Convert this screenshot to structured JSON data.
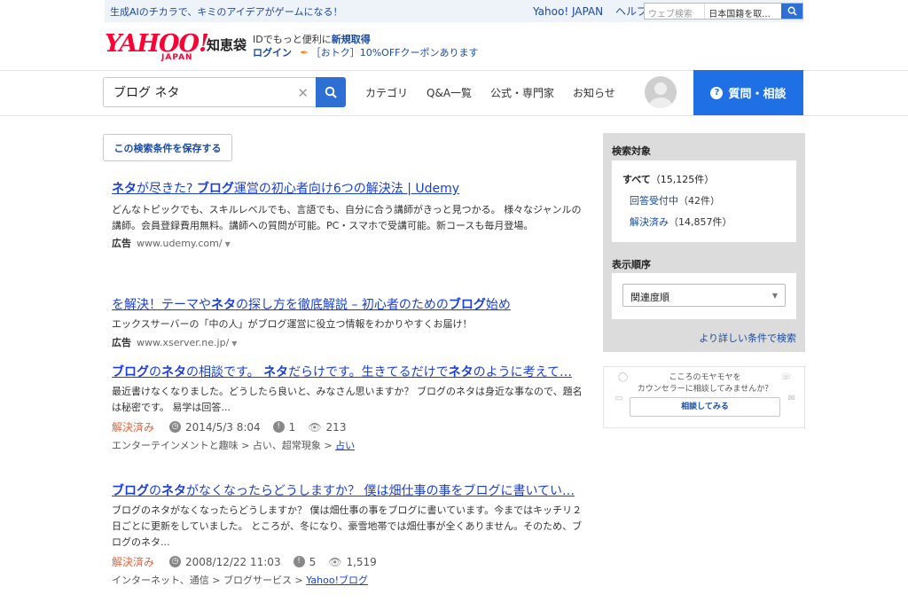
{
  "top_bar": {
    "promo": "生成AIのチカラで、キミのアイデアがゲームになる！",
    "links": [
      "Yahoo! JAPAN",
      "ヘルプ"
    ],
    "search_placeholder": "ウェブ検索",
    "search_scope": "日本国籍を取..."
  },
  "header": {
    "logo_text": "YAHOO!",
    "logo_sub": "JAPAN",
    "service_name": "知恵袋",
    "login_line1_prefix": "IDでもっと便利に",
    "login_line1_link": "新規取得",
    "login_label": "ログイン",
    "coupon_text": "［おトク］10%OFFクーポンあります"
  },
  "nav": {
    "search_value": "ブログ ネタ",
    "items": [
      "カテゴリ",
      "Q&A一覧",
      "公式・専門家",
      "お知らせ"
    ],
    "ask_button": "質問・相談"
  },
  "main": {
    "save_search": "この検索条件を保存する",
    "results": [
      {
        "title_parts": [
          [
            "ネタ",
            true
          ],
          [
            "が尽きた? ",
            false
          ],
          [
            "ブログ",
            true
          ],
          [
            "運営の初心者向け6つの解決法 | Udemy",
            false
          ]
        ],
        "snippet": "どんなトピックでも、スキルレベルでも、言語でも、自分に合う講師がきっと見つかる。 様々なジャンルの講師。会員登録費用無料。講師への質問が可能。PC・スマホで受講可能。新コースも毎月登場。",
        "ad_label": "広告",
        "url": "www.udemy.com/"
      },
      {
        "title_parts": [
          [
            "を解決！テーマや",
            false
          ],
          [
            "ネタ",
            true
          ],
          [
            "の探し方を徹底解説 – 初心者のための",
            false
          ],
          [
            "ブログ",
            true
          ],
          [
            "始め",
            false
          ]
        ],
        "snippet": "エックスサーバーの「中の人」がブログ運営に役立つ情報をわかりやすくお届け！",
        "ad_label": "広告",
        "url": "www.xserver.ne.jp/"
      },
      {
        "title_parts": [
          [
            "ブログ",
            true
          ],
          [
            "の",
            false
          ],
          [
            "ネタ",
            true
          ],
          [
            "の相談です。 ",
            false
          ],
          [
            "ネタ",
            true
          ],
          [
            "だらけです。生きてるだけで",
            false
          ],
          [
            "ネタ",
            true
          ],
          [
            "のように考えて…",
            false
          ]
        ],
        "snippet": "最近書けなくなりました。どうしたら良いと、みなさん思いますか？ ブログのネタは身近な事なので、題名は秘密です。 易学は回答...",
        "status": "解決済み",
        "date": "2014/5/3 8:04",
        "answers": "1",
        "views": "213",
        "category_path": "エンターテインメントと趣味 > 占い、超常現象 > ",
        "category_link": "占い"
      },
      {
        "title_parts": [
          [
            "ブログ",
            true
          ],
          [
            "の",
            false
          ],
          [
            "ネタ",
            true
          ],
          [
            "がなくなったらどうしますか？ 僕は畑仕事の事をブログに書いてい…",
            false
          ]
        ],
        "snippet": "ブログのネタがなくなったらどうしますか？ 僕は畑仕事の事をブログに書いています。今まではキッチリ２日ごとに更新をしていました。 ところが、冬になり、豪雪地帯では畑仕事が全くありません。そのため、ブログのネタ...",
        "status": "解決済み",
        "date": "2008/12/22 11:03",
        "answers": "5",
        "views": "1,519",
        "category_path": "インターネット、通信 > ブログサービス > ",
        "category_link": "Yahoo!ブログ"
      }
    ]
  },
  "sidebar": {
    "filter_heading": "検索対象",
    "all_label": "すべて",
    "all_count": "（15,125件）",
    "open_label": "回答受付中",
    "open_count": "（42件）",
    "resolved_label": "解決済み",
    "resolved_count": "（14,857件）",
    "sort_heading": "表示順序",
    "sort_value": "関連度順",
    "more_conditions": "より詳しい条件で検索",
    "counsel_line1": "こころのモヤモヤを",
    "counsel_line2": "カウンセラーに相談してみませんか？",
    "counsel_button": "相談してみる"
  },
  "colors": {
    "accent_blue": "#1f6fe5",
    "link_blue": "#1a3fd6",
    "resolved_orange": "#e8623d",
    "logo_red": "#ff0033"
  }
}
